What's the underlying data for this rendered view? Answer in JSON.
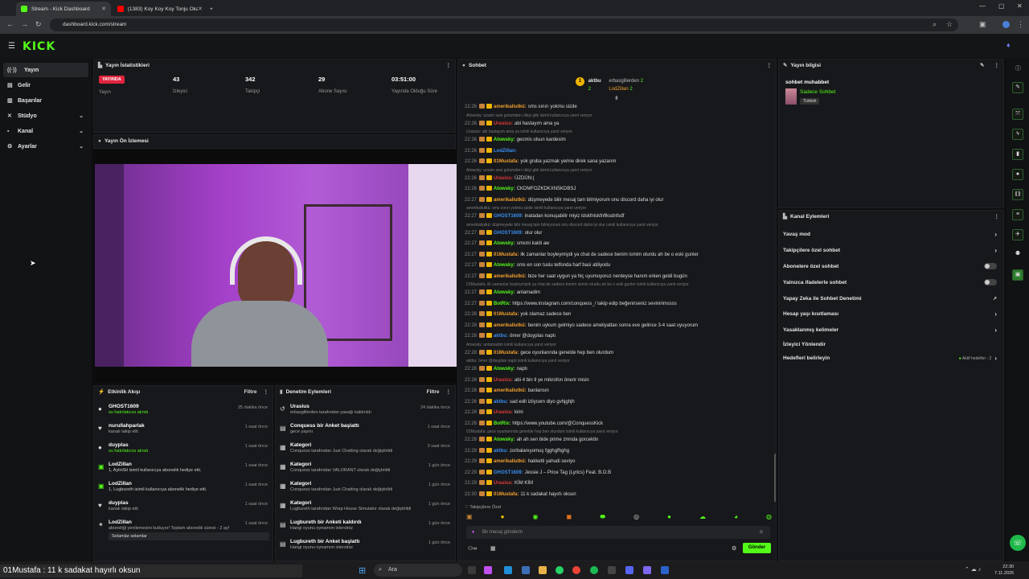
{
  "browser": {
    "tabs": [
      {
        "label": "Stream - Kick Dashboard"
      },
      {
        "label": "(1383) Koy Koy Koy Tonju Okan..."
      }
    ],
    "url": "dashboard.kick.com/stream"
  },
  "logo": "KICK",
  "sidebar": {
    "items": [
      {
        "label": "Yayın"
      },
      {
        "label": "Gelir"
      },
      {
        "label": "Başarılar"
      },
      {
        "label": "Stüdyo"
      },
      {
        "label": "Kanal"
      },
      {
        "label": "Ayarlar"
      }
    ]
  },
  "stats": {
    "title": "Yayın İstatistikleri",
    "live_badge": "YAYINDA",
    "live_label": "Yayın",
    "items": [
      {
        "value": "43",
        "label": "İzleyici"
      },
      {
        "value": "342",
        "label": "Takipçi"
      },
      {
        "value": "29",
        "label": "Abone Sayısı"
      },
      {
        "value": "03:51:00",
        "label": "Yayında Olduğu Süre"
      }
    ]
  },
  "preview": {
    "title": "Yayın Ön İzlemesi"
  },
  "activity": {
    "title": "Etkinlik Akışı",
    "filter": "Filtre",
    "items": [
      {
        "name": "GHOST1609",
        "sub": "su hatırlatıcısı alındı",
        "time": "25 dakika önce"
      },
      {
        "name": "nurullahparlak",
        "sub": "kanalı takip etti",
        "time": "1 saat önce"
      },
      {
        "name": "duyplas",
        "sub": "su hatırlatıcısı alındı",
        "time": "1 saat önce"
      },
      {
        "name": "LodZillan",
        "sub": "1, AylinSit isimli kullanıcıya abonelik hediye etti.",
        "time": "1 saat önce"
      },
      {
        "name": "LodZillan",
        "sub": "1, Lugbureth isimli kullanıcıya abonelik hediye etti.",
        "time": "1 saat önce"
      },
      {
        "name": "duyplas",
        "sub": "kanalı takip etti",
        "time": "1 saat önce"
      },
      {
        "name": "LodZillan",
        "sub": "aboneliği yenilemesini kutluyor! Toplam abonelik süresi - 2 ay!",
        "time": "1 saat önce"
      }
    ],
    "extra": "Selamlar selamlar"
  },
  "moderation": {
    "title": "Denetim Eylemleri",
    "filter": "Filtre",
    "items": [
      {
        "name": "Urasius",
        "sub": "erbasgillerden tarafından yasağı kaldırıldı",
        "time": "24 dakika önce"
      },
      {
        "name": "Conquess bir Anket başlattı",
        "sub": "gece yayını",
        "time": "1 saat önce"
      },
      {
        "name": "Kategori",
        "sub": "Conquess tarafından Just Chatting olarak değiştirildi",
        "time": "3 saat önce"
      },
      {
        "name": "Kategori",
        "sub": "Conquess tarafından VALORANT olarak değiştirildi",
        "time": "1 gün önce"
      },
      {
        "name": "Kategori",
        "sub": "Conquess tarafından Just Chatting olarak değiştirildi",
        "time": "1 gün önce"
      },
      {
        "name": "Kategori",
        "sub": "Lugbureth tarafından Wrap House Simulator olarak değiştirildi",
        "time": "1 gün önce"
      },
      {
        "name": "Lugbureth bir Anketi kaldırdı",
        "sub": "Hangi oyunu oynamım istersiniz",
        "time": "1 gün önce"
      },
      {
        "name": "Lugbureth bir Anket başlattı",
        "sub": "Hangi oyunu oynamım istersiniz",
        "time": "1 gün önce"
      }
    ]
  },
  "chat": {
    "title": "Sohbet",
    "top": [
      {
        "name": "aktbu",
        "count": "2"
      },
      {
        "name": "erbasgillerden",
        "count": "2"
      },
      {
        "name": "LodZillan",
        "count": "2"
      }
    ],
    "lines": [
      {
        "time": "22:26",
        "user": "amerikaliutkü:",
        "color": "#f0a030",
        "msg": "sms sınırı yokmu sizde"
      },
      {
        "reply": "Atowsky: urasin sesi gotumden cikiyi gibi isimli kullanıcıya yanıt veriyor"
      },
      {
        "time": "22:26",
        "user": "Urasius:",
        "color": "#e03a3a",
        "msg": "abi hastayım ama ya"
      },
      {
        "reply": "Urasius: abi hastayım ama ya isimli kullanıcıya yanıt veriyor"
      },
      {
        "time": "22:26",
        "user": "Atowsky:",
        "color": "#53fc18",
        "msg": "gecmis olsun kardesim"
      },
      {
        "time": "22:26",
        "user": "LodZillan:",
        "color": "#3a8ef0",
        "msg": ""
      },
      {
        "time": "22:26",
        "user": "01Mustafa:",
        "color": "#f0a030",
        "msg": "yok gruba yazmak yerine direk sana yazarım"
      },
      {
        "reply": "Atowsky: urasin sesi gotumden cikiyi gibi isimli kullanıcıya yanıt veriyor"
      },
      {
        "time": "22:26",
        "user": "Urasius:",
        "color": "#e03a3a",
        "msg": "ÜZDÜN:("
      },
      {
        "time": "22:26",
        "user": "Atowsky:",
        "color": "#53fc18",
        "msg": "CKDMFOZKDKXNSKDBSJ"
      },
      {
        "time": "22:27",
        "user": "amerikaliutkü:",
        "color": "#f0a030",
        "msg": "düşmeyede bilir mesaj tam bilmiyorum onu discord daha iyi olur"
      },
      {
        "reply": "amerikaliutkü: sms sınırı yokmu sizde isimli kullanıcıya yanıt veriyor"
      },
      {
        "time": "22:27",
        "user": "GHOST1609:",
        "color": "#3a8ef0",
        "msg": "inatadan konuşabilir miyiz ldskfnlskfnflksdnfsdf"
      },
      {
        "reply": "amerikaliutkü: düşmeyede bilir mesaj tam bilmiyorum onu discord daha iyi olur isimli kullanıcıya yanıt veriyor"
      },
      {
        "time": "22:27",
        "user": "GHOST1609:",
        "color": "#3a8ef0",
        "msg": "olur olur"
      },
      {
        "time": "22:27",
        "user": "Atowsky:",
        "color": "#53fc18",
        "msg": "smsmi kaldi aw"
      },
      {
        "time": "22:27",
        "user": "01Mustafa:",
        "color": "#f0a030",
        "msg": "ilk zamanlar boyleymiydi ya chat de sadece benim ismim olurdu ah be o eski gunler"
      },
      {
        "time": "22:27",
        "user": "Atowsky:",
        "color": "#53fc18",
        "msg": "sms en son tuslu telfonda harf basi atiliyodu"
      },
      {
        "time": "22:27",
        "user": "amerikaliutkü:",
        "color": "#f0a030",
        "msg": "bize her saat uygun ya hiç uyumuyoruz nerdeyse hanım erken geldi bugün"
      },
      {
        "reply": "01Mustafa: ilk zamanlar boyleymiydi ya chat de sadece benim ismim olurdu ah be o eski gunler isimli kullanıcıya yanıt veriyor"
      },
      {
        "time": "22:27",
        "user": "Atowsky:",
        "color": "#53fc18",
        "msg": "anlamadim"
      },
      {
        "time": "22:27",
        "user": "BotRix:",
        "color": "#53fc18",
        "msg": "https://www.instagram.com/conquess_/ takip edip beğenirseniz sevinirimssss"
      },
      {
        "time": "22:28",
        "user": "01Mustafa:",
        "color": "#f0a030",
        "msg": "yok olamaz sadece ben"
      },
      {
        "time": "22:28",
        "user": "amerikaliutkü:",
        "color": "#f0a030",
        "msg": "benim uykum gelmiyo sadece ameliyattan sonra eve gelince 3-4 saat uyuyorum"
      },
      {
        "time": "22:28",
        "user": "aktbu:",
        "color": "#3a8ef0",
        "msg": "ömer @duyplas naptı"
      },
      {
        "reply": "Atowsky: anlamadim isimli kullanıcıya yanıt veriyor"
      },
      {
        "time": "22:28",
        "user": "01Mustafa:",
        "color": "#f0a030",
        "msg": "gece oyunlarında genelde hep ben olurdum"
      },
      {
        "reply": "aktbu: ömer @duyplas naptı isimli kullanıcıya yanıt veriyor"
      },
      {
        "time": "22:28",
        "user": "Atowsky:",
        "color": "#53fc18",
        "msg": "naptı"
      },
      {
        "time": "22:28",
        "user": "Urasius:",
        "color": "#e03a3a",
        "msg": "abi 4 bin tl ye mikrofon önerir misin"
      },
      {
        "time": "22:28",
        "user": "amerikaliutkü:",
        "color": "#f0a030",
        "msg": "banlansın"
      },
      {
        "time": "22:28",
        "user": "aktbu:",
        "color": "#3a8ef0",
        "msg": "sad edit izliycem diyo gvhjghjh"
      },
      {
        "time": "22:28",
        "user": "Urasius:",
        "color": "#e03a3a",
        "msg": "kimi"
      },
      {
        "time": "22:28",
        "user": "BotRix:",
        "color": "#53fc18",
        "msg": "https://www.youtube.com/@ConquessKick"
      },
      {
        "reply": "01Mustafa: gece oyunlarında genelde hep ben olurdum isimli kullanıcıya yanıt veriyor"
      },
      {
        "time": "22:28",
        "user": "Atowsky:",
        "color": "#53fc18",
        "msg": "ah ah sen bide prime zmnda gorcektin"
      },
      {
        "time": "22:28",
        "user": "aktbu:",
        "color": "#3a8ef0",
        "msg": "zorbalanıyomuş fgghgfhghg"
      },
      {
        "time": "22:29",
        "user": "amerikaliutkü:",
        "color": "#f0a030",
        "msg": "hakketti yahudi seviyo"
      },
      {
        "time": "22:29",
        "user": "GHOST1609:",
        "color": "#3a8ef0",
        "msg": "Jessie J – Price Tag (Lyrics) Feat. B.O.B"
      },
      {
        "time": "22:29",
        "user": "Urasius:",
        "color": "#e03a3a",
        "msg": "KİM KİM"
      },
      {
        "time": "22:30",
        "user": "01Mustafa:",
        "color": "#f0a030",
        "msg": "11 k sadakat hayırlı oksun"
      }
    ],
    "followers_only": "Takipçilere Özel",
    "input_placeholder": "Bir mesaj gönderin",
    "send": "Gönder"
  },
  "info": {
    "title": "Yayın bilgisi",
    "stream_title": "sohbet muhabbet",
    "category": "Sadece Sohbet",
    "tag": "Türkish"
  },
  "actions": {
    "title": "Kanal Eylemleri",
    "items": [
      {
        "label": "Yavaş mod",
        "kind": "chevron"
      },
      {
        "label": "Takipçilere özel sohbet",
        "kind": "chevron"
      },
      {
        "label": "Abonelere özel sohbet",
        "kind": "toggle"
      },
      {
        "label": "Yalnızca ifadelerle sohbet",
        "kind": "toggle"
      },
      {
        "label": "Yapay Zeka ile Sohbet Denetimi",
        "kind": "ext"
      },
      {
        "label": "Hesap yaşı kısıtlaması",
        "kind": "chevron"
      },
      {
        "label": "Yasaklanmış kelimeler",
        "kind": "chevron"
      },
      {
        "label": "İzleyici Yönlendir",
        "kind": "none"
      },
      {
        "label": "Hedefleri belirleyin",
        "kind": "goal"
      }
    ],
    "goal_status": "Aktif hedefler - 2"
  },
  "overlay": {
    "subtitle": "01Mustafa : 11 k sadakat hayırlı oksun"
  },
  "taskbar": {
    "search": "Ara",
    "time": "22:30",
    "date": "7.11.2025"
  },
  "colors": {
    "accent": "#53fc18",
    "live": "#e0243f",
    "panel": "#17181b"
  }
}
